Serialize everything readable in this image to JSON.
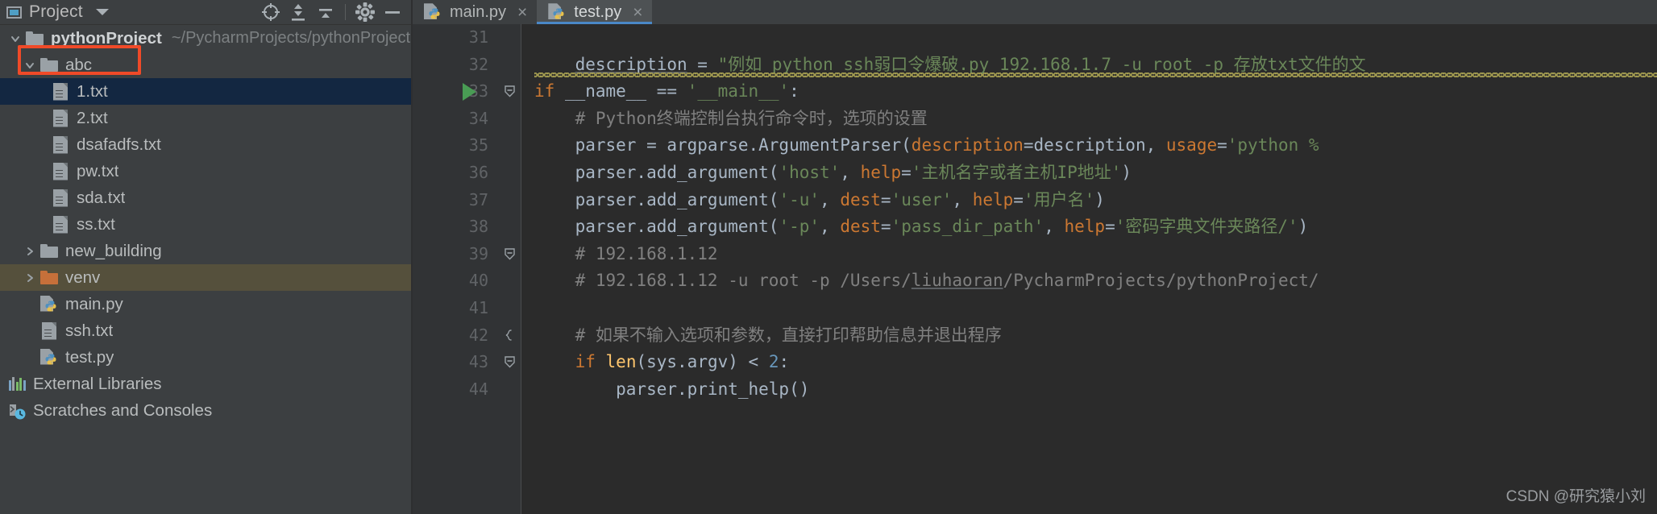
{
  "sidebar": {
    "header": {
      "title": "Project",
      "window_icon": "project-window-icon",
      "dropdown_icon": "chevron-down-icon",
      "actions": [
        {
          "name": "locate-target-icon",
          "glyph": "target"
        },
        {
          "name": "expand-all-icon",
          "glyph": "expand-all"
        },
        {
          "name": "collapse-all-icon",
          "glyph": "collapse-all"
        },
        {
          "name": "settings-gear-icon",
          "glyph": "gear"
        },
        {
          "name": "hide-panel-icon",
          "glyph": "minus"
        }
      ]
    },
    "tree": [
      {
        "label": "pythonProject",
        "hint": "~/PycharmProjects/pythonProject",
        "icon": "folder",
        "indent": 0,
        "arrow": "down",
        "bold": true,
        "state": "normal"
      },
      {
        "label": "abc",
        "hint": "",
        "icon": "folder",
        "indent": 1,
        "arrow": "down",
        "bold": false,
        "state": "annotated"
      },
      {
        "label": "1.txt",
        "hint": "",
        "icon": "text-file",
        "indent": 2,
        "arrow": "none",
        "bold": false,
        "state": "selected"
      },
      {
        "label": "2.txt",
        "hint": "",
        "icon": "text-file",
        "indent": 2,
        "arrow": "none",
        "bold": false,
        "state": "normal"
      },
      {
        "label": "dsafadfs.txt",
        "hint": "",
        "icon": "text-file",
        "indent": 2,
        "arrow": "none",
        "bold": false,
        "state": "normal"
      },
      {
        "label": "pw.txt",
        "hint": "",
        "icon": "text-file",
        "indent": 2,
        "arrow": "none",
        "bold": false,
        "state": "normal"
      },
      {
        "label": "sda.txt",
        "hint": "",
        "icon": "text-file",
        "indent": 2,
        "arrow": "none",
        "bold": false,
        "state": "normal"
      },
      {
        "label": "ss.txt",
        "hint": "",
        "icon": "text-file",
        "indent": 2,
        "arrow": "none",
        "bold": false,
        "state": "normal"
      },
      {
        "label": "new_building",
        "hint": "",
        "icon": "folder",
        "indent": 1,
        "arrow": "right",
        "bold": false,
        "state": "normal"
      },
      {
        "label": "venv",
        "hint": "",
        "icon": "folder-orange",
        "indent": 1,
        "arrow": "right",
        "bold": false,
        "state": "highlighted"
      },
      {
        "label": "main.py",
        "hint": "",
        "icon": "python-file",
        "indent": 1,
        "arrow": "none",
        "bold": false,
        "state": "normal"
      },
      {
        "label": "ssh.txt",
        "hint": "",
        "icon": "text-file",
        "indent": 1,
        "arrow": "none",
        "bold": false,
        "state": "normal"
      },
      {
        "label": "test.py",
        "hint": "",
        "icon": "python-file",
        "indent": 1,
        "arrow": "none",
        "bold": false,
        "state": "normal"
      },
      {
        "label": "External Libraries",
        "hint": "",
        "icon": "libraries",
        "indent": 0,
        "arrow": "none",
        "bold": false,
        "state": "normal"
      },
      {
        "label": "Scratches and Consoles",
        "hint": "",
        "icon": "scratches",
        "indent": 0,
        "arrow": "none",
        "bold": false,
        "state": "normal"
      }
    ]
  },
  "editor": {
    "tabs": [
      {
        "label": "main.py",
        "icon": "python-file",
        "active": false,
        "close": "×"
      },
      {
        "label": "test.py",
        "icon": "python-file",
        "active": true,
        "close": "×"
      }
    ],
    "line_numbers": [
      "31",
      "32",
      "33",
      "34",
      "35",
      "36",
      "37",
      "38",
      "39",
      "40",
      "41",
      "42",
      "43",
      "44"
    ],
    "lines": [
      {
        "n": "31",
        "text": "",
        "tokens": []
      },
      {
        "n": "32",
        "text": "    description = \"例如 python ssh弱口令爆破.py 192.168.1.7 -u root -p 存放txt文件的文",
        "tokens": [
          {
            "t": "    ",
            "c": "idn"
          },
          {
            "t": "description",
            "c": "idn underline-ident"
          },
          {
            "t": " = ",
            "c": "idn"
          },
          {
            "t": "\"例如 python ssh弱口令爆破.py 192.168.1.7 -u root -p 存放txt文件的文",
            "c": "str"
          }
        ],
        "wavy": true
      },
      {
        "n": "33",
        "text": "if __name__ == '__main__':",
        "tokens": [
          {
            "t": "if",
            "c": "kw"
          },
          {
            "t": " __name__ ",
            "c": "idn"
          },
          {
            "t": "==",
            "c": "idn"
          },
          {
            "t": " ",
            "c": "idn"
          },
          {
            "t": "'__main__'",
            "c": "str"
          },
          {
            "t": ":",
            "c": "idn"
          }
        ],
        "run_marker": true,
        "fold": "minus"
      },
      {
        "n": "34",
        "text": "    # Python终端控制台执行命令时，选项的设置",
        "tokens": [
          {
            "t": "    # Python终端控制台执行命令时，选项的设置",
            "c": "com"
          }
        ]
      },
      {
        "n": "35",
        "text": "    parser = argparse.ArgumentParser(description=description, usage='python %",
        "tokens": [
          {
            "t": "    parser = argparse.ArgumentParser(",
            "c": "idn"
          },
          {
            "t": "description",
            "c": "kwarg"
          },
          {
            "t": "=description, ",
            "c": "idn"
          },
          {
            "t": "usage",
            "c": "kwarg"
          },
          {
            "t": "=",
            "c": "idn"
          },
          {
            "t": "'python %",
            "c": "str"
          }
        ]
      },
      {
        "n": "36",
        "text": "    parser.add_argument('host', help='主机名字或者主机IP地址')",
        "tokens": [
          {
            "t": "    parser.add_argument(",
            "c": "idn"
          },
          {
            "t": "'host'",
            "c": "str"
          },
          {
            "t": ", ",
            "c": "idn"
          },
          {
            "t": "help",
            "c": "kwarg"
          },
          {
            "t": "=",
            "c": "idn"
          },
          {
            "t": "'主机名字或者主机IP地址'",
            "c": "str"
          },
          {
            "t": ")",
            "c": "idn"
          }
        ]
      },
      {
        "n": "37",
        "text": "    parser.add_argument('-u', dest='user', help='用户名')",
        "tokens": [
          {
            "t": "    parser.add_argument(",
            "c": "idn"
          },
          {
            "t": "'-u'",
            "c": "str"
          },
          {
            "t": ", ",
            "c": "idn"
          },
          {
            "t": "dest",
            "c": "kwarg"
          },
          {
            "t": "=",
            "c": "idn"
          },
          {
            "t": "'user'",
            "c": "str"
          },
          {
            "t": ", ",
            "c": "idn"
          },
          {
            "t": "help",
            "c": "kwarg"
          },
          {
            "t": "=",
            "c": "idn"
          },
          {
            "t": "'用户名'",
            "c": "str"
          },
          {
            "t": ")",
            "c": "idn"
          }
        ]
      },
      {
        "n": "38",
        "text": "    parser.add_argument('-p', dest='pass_dir_path', help='密码字典文件夹路径/')",
        "tokens": [
          {
            "t": "    parser.add_argument(",
            "c": "idn"
          },
          {
            "t": "'-p'",
            "c": "str"
          },
          {
            "t": ", ",
            "c": "idn"
          },
          {
            "t": "dest",
            "c": "kwarg"
          },
          {
            "t": "=",
            "c": "idn"
          },
          {
            "t": "'pass_dir_path'",
            "c": "str"
          },
          {
            "t": ", ",
            "c": "idn"
          },
          {
            "t": "help",
            "c": "kwarg"
          },
          {
            "t": "=",
            "c": "idn"
          },
          {
            "t": "'密码字典文件夹路径/'",
            "c": "str"
          },
          {
            "t": ")",
            "c": "idn"
          }
        ]
      },
      {
        "n": "39",
        "text": "    # 192.168.1.12",
        "tokens": [
          {
            "t": "    # 192.168.1.12",
            "c": "com"
          }
        ],
        "fold": "minus"
      },
      {
        "n": "40",
        "text": "    # 192.168.1.12 -u root -p /Users/liuhaoran/PycharmProjects/pythonProject/",
        "tokens": [
          {
            "t": "    # 192.168.1.12 -u root -p /Users/",
            "c": "com"
          },
          {
            "t": "liuhaoran",
            "c": "com underline-ident"
          },
          {
            "t": "/PycharmProjects/pythonProject/",
            "c": "com"
          }
        ]
      },
      {
        "n": "41",
        "text": "",
        "tokens": []
      },
      {
        "n": "42",
        "text": "    # 如果不输入选项和参数，直接打印帮助信息并退出程序",
        "tokens": [
          {
            "t": "    # 如果不输入选项和参数，直接打印帮助信息并退出程序",
            "c": "com"
          }
        ],
        "fold": "brace"
      },
      {
        "n": "43",
        "text": "    if len(sys.argv) < 2:",
        "tokens": [
          {
            "t": "    ",
            "c": "idn"
          },
          {
            "t": "if",
            "c": "kw"
          },
          {
            "t": " ",
            "c": "idn"
          },
          {
            "t": "len",
            "c": "fn"
          },
          {
            "t": "(sys.argv) < ",
            "c": "idn"
          },
          {
            "t": "2",
            "c": "num"
          },
          {
            "t": ":",
            "c": "idn"
          }
        ],
        "fold": "minus"
      },
      {
        "n": "44",
        "text": "        parser.print_help()",
        "tokens": [
          {
            "t": "        parser.print_help()",
            "c": "idn"
          }
        ]
      }
    ]
  },
  "watermark": "CSDN @研究猿小刘",
  "colors": {
    "panel_bg": "#3c3f41",
    "editor_bg": "#2b2b2b",
    "gutter_bg": "#313335",
    "selection_blue": "#132741",
    "venv_highlight": "#55503c",
    "annotation_red": "#f04a28",
    "tab_active_underline": "#4a88c7",
    "string_green": "#6a8759",
    "keyword_orange": "#cc7832",
    "comment_gray": "#808080",
    "number_blue": "#6897bb",
    "function_yellow": "#ffc66d",
    "run_marker_green": "#499c54",
    "warning_wave": "#a9a253"
  }
}
